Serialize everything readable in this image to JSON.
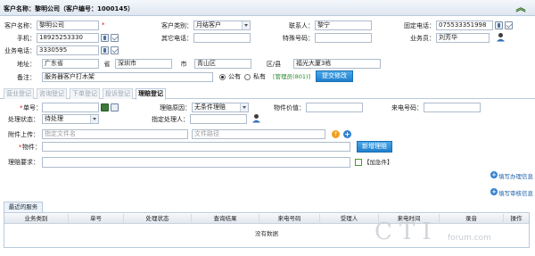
{
  "header": {
    "title": "客户名称：黎明公司（客户编号：1000145）"
  },
  "form": {
    "customer_name": {
      "label": "客户名称：",
      "value": "黎明公司"
    },
    "customer_type": {
      "label": "客户类别：",
      "value": "月结客户"
    },
    "contact": {
      "label": "联系人：",
      "value": "黎宁"
    },
    "fixed_phone": {
      "label": "固定电话：",
      "value": "075533351998"
    },
    "mobile": {
      "label": "手机：",
      "value": "18925253330"
    },
    "other_phone": {
      "label": "其它电话：",
      "value": ""
    },
    "special_no": {
      "label": "特殊号码：",
      "value": ""
    },
    "salesman": {
      "label": "业务员：",
      "value": "刘芳华"
    },
    "office_phone": {
      "label": "业务电话：",
      "value": "3330595"
    },
    "address": {
      "label": "地址：",
      "province": "广东省",
      "province_unit": "省",
      "city": "深圳市",
      "city_unit": "市",
      "district": "青山区",
      "district_unit": "区/县",
      "street": "福光大厦3栋"
    },
    "remark": {
      "label": "备注：",
      "value": "服务器客户打木架"
    },
    "visibility": {
      "public": "公有",
      "private": "私有",
      "admin_text": "[管理员(801)]"
    },
    "submit_label": "提交修改"
  },
  "tabs": [
    {
      "label": "营业登记",
      "active": false
    },
    {
      "label": "咨询登记",
      "active": false
    },
    {
      "label": "下单登记",
      "active": false
    },
    {
      "label": "投诉登记",
      "active": false
    },
    {
      "label": "理赔登记",
      "active": true
    }
  ],
  "claim": {
    "order_no": {
      "label": "单号：",
      "value": ""
    },
    "claim_reason": {
      "label": "理赔原因：",
      "value": "无条件理赔"
    },
    "item_value": {
      "label": "物件价值：",
      "value": ""
    },
    "incoming_no": {
      "label": "来电号码：",
      "value": ""
    },
    "status": {
      "label": "处理状态：",
      "value": "待处理"
    },
    "handler": {
      "label": "指定处理人：",
      "value": ""
    },
    "attachment": {
      "label": "附件上传：",
      "file_placeholder": "指定文件名",
      "path_placeholder": "文件路径"
    },
    "item": {
      "label": "物件：",
      "value": ""
    },
    "new_claim_label": "新增理赔",
    "requirement": {
      "label": "理赔要求：",
      "value": ""
    },
    "urgent_label": "【加急件】"
  },
  "side_links": {
    "fill_process": "填写办理信息",
    "fill_review": "填写审核信息"
  },
  "recent": {
    "title": "最近的服务",
    "columns": [
      "业务类别",
      "单号",
      "处理状态",
      "查询结果",
      "来电号码",
      "受理人",
      "来电时间",
      "录音",
      "操作"
    ],
    "empty": "没有数据"
  },
  "watermark": {
    "text": "CTI",
    "sub": "forum.com"
  },
  "colors": {
    "header_bg": "#dfe7f1",
    "accent": "#1f7fcc",
    "green": "#2a8a2a",
    "border": "#b9c9dd"
  }
}
